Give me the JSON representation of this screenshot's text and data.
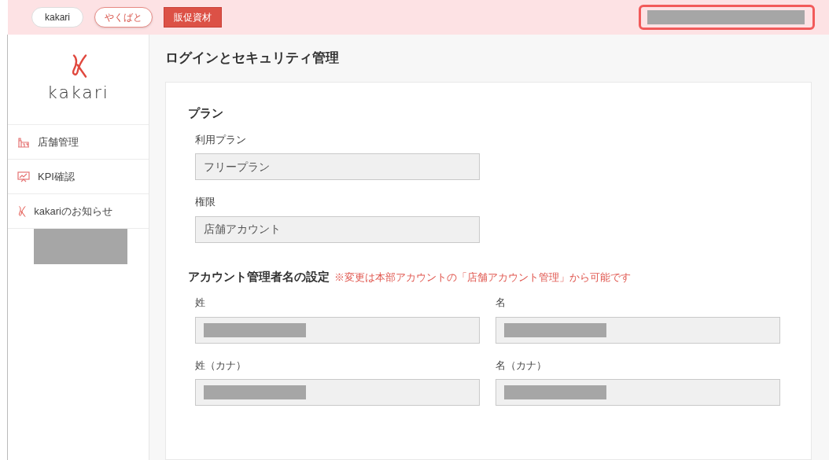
{
  "top_nav": {
    "tabs": [
      {
        "label": "kakari",
        "kind": "plain",
        "selected": false
      },
      {
        "label": "やくばと",
        "kind": "accent",
        "selected": false
      },
      {
        "label": "販促資材",
        "kind": "accent",
        "selected": true
      }
    ]
  },
  "sidebar": {
    "logo_text": "kakari",
    "items": [
      {
        "label": "店舗管理",
        "kind": "store"
      },
      {
        "label": "KPI確認",
        "kind": "chart"
      },
      {
        "label": "kakariのお知らせ",
        "kind": "logo"
      }
    ]
  },
  "page_title": "ログインとセキュリティ管理",
  "sections": [
    {
      "title": "プラン",
      "rows": [
        [
          {
            "label": "利用プラン",
            "value": "フリープラン"
          }
        ],
        [
          {
            "label": "権限",
            "value": "店舗アカウント"
          }
        ]
      ]
    },
    {
      "title": "アカウント管理者名の設定",
      "note": "※変更は本部アカウントの「店舗アカウント管理」から可能です",
      "rows": [
        [
          {
            "label": "姓"
          },
          {
            "label": "名"
          }
        ],
        [
          {
            "label": "姓（カナ）"
          },
          {
            "label": "名（カナ）"
          }
        ]
      ]
    }
  ]
}
